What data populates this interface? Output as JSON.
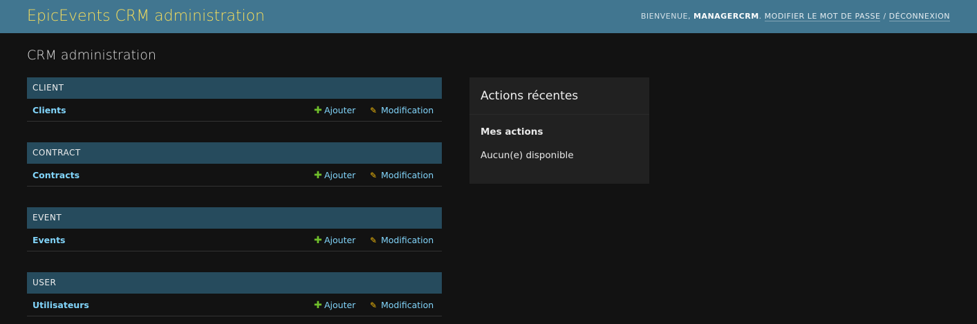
{
  "header": {
    "branding": "EpicEvents CRM administration",
    "welcome": "Bienvenue,",
    "username": "managercrm",
    "change_password": "Modifier le mot de passe",
    "separator": "/",
    "logout": "Déconnexion"
  },
  "site_title": "CRM administration",
  "modules": [
    {
      "caption": "Client",
      "model": "Clients",
      "add": "Ajouter",
      "change": "Modification"
    },
    {
      "caption": "Contract",
      "model": "Contracts",
      "add": "Ajouter",
      "change": "Modification"
    },
    {
      "caption": "Event",
      "model": "Events",
      "add": "Ajouter",
      "change": "Modification"
    },
    {
      "caption": "User",
      "model": "Utilisateurs",
      "add": "Ajouter",
      "change": "Modification"
    }
  ],
  "recent_actions": {
    "title": "Actions récentes",
    "subtitle": "Mes actions",
    "empty": "Aucun(e) disponible"
  },
  "icons": {
    "add": "plus-icon",
    "change": "pencil-icon"
  },
  "colors": {
    "header_bg": "#417690",
    "branding": "#f5dd5d",
    "module_caption_bg": "#264b5d",
    "link": "#81d4fa",
    "add_icon": "#70bf2b",
    "change_icon": "#efb80b",
    "page_bg": "#121212"
  }
}
